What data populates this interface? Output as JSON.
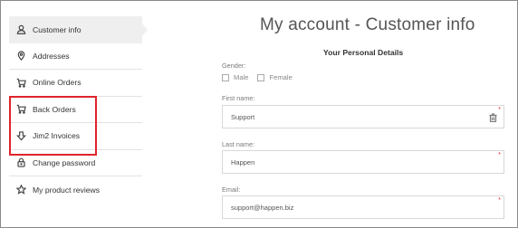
{
  "sidebar": {
    "items": [
      {
        "label": "Customer info",
        "icon": "user-icon",
        "active": true
      },
      {
        "label": "Addresses",
        "icon": "location-pin-icon"
      },
      {
        "label": "Online Orders",
        "icon": "cart-icon"
      },
      {
        "label": "Back Orders",
        "icon": "cart-icon"
      },
      {
        "label": "Jim2 Invoices",
        "icon": "download-icon"
      },
      {
        "label": "Change password",
        "icon": "lock-icon"
      },
      {
        "label": "My product reviews",
        "icon": "star-icon"
      }
    ]
  },
  "main": {
    "title": "My account - Customer info",
    "section_title": "Your Personal Details",
    "gender": {
      "label": "Gender:",
      "options": [
        "Male",
        "Female"
      ]
    },
    "first_name": {
      "label": "First name:",
      "value": "Support"
    },
    "last_name": {
      "label": "Last name:",
      "value": "Happen"
    },
    "email": {
      "label": "Email:",
      "value": "support@happen.biz"
    },
    "required_marker": "*"
  },
  "colors": {
    "highlight": "#e0242b",
    "active_bg": "#efefef",
    "required": "#e0242b"
  }
}
